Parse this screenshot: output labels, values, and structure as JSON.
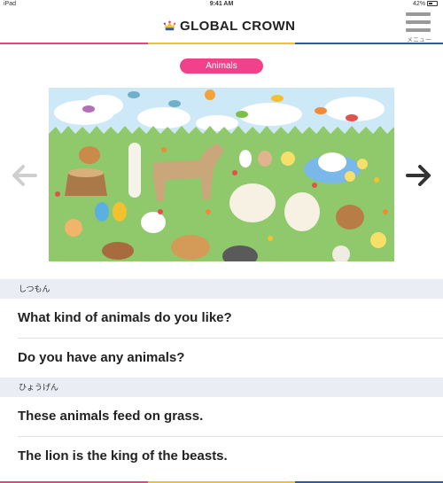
{
  "status_bar": {
    "device": "iPad",
    "time": "9:41 AM",
    "battery": "42%"
  },
  "header": {
    "logo_text": "GLOBAL CROWN",
    "menu_label": "メニュー"
  },
  "stripe_colors": [
    "#e8437d",
    "#f2c12e",
    "#2f5aa3"
  ],
  "category_tag": "Animals",
  "navigation": {
    "prev_icon": "arrow-left-icon",
    "next_icon": "arrow-right-icon"
  },
  "sections": [
    {
      "title": "しつもん",
      "phrases": [
        "What kind of animals do you like?",
        "Do you have any animals?"
      ]
    },
    {
      "title": "ひょうげん",
      "phrases": [
        "These animals feed on grass.",
        "The lion is the king of the beasts."
      ]
    }
  ],
  "colors": {
    "tag_pink": "#f0418a",
    "sky": "#cde9f7",
    "grass": "#8fc96b",
    "section_bg": "#eaedf3"
  }
}
